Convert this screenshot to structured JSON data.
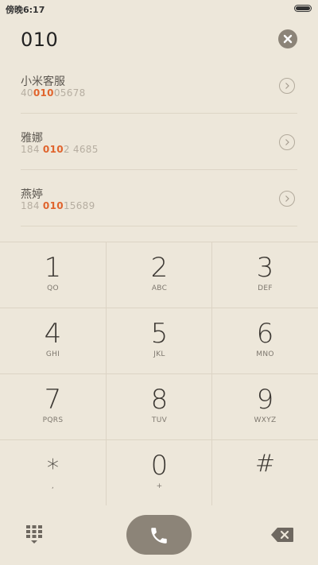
{
  "status_bar": {
    "time": "傍晚6:17"
  },
  "dial_input": {
    "value": "010"
  },
  "results": [
    {
      "name": "小米客服",
      "num_pre": "40",
      "num_hl": "010",
      "num_post": "05678"
    },
    {
      "name": "雅娜",
      "num_pre": "184 ",
      "num_hl": "010",
      "num_post": "2 4685"
    },
    {
      "name": "燕婷",
      "num_pre": "184 ",
      "num_hl": "010",
      "num_post": "15689"
    }
  ],
  "keypad": [
    {
      "digit": "1",
      "letters": "QO"
    },
    {
      "digit": "2",
      "letters": "ABC"
    },
    {
      "digit": "3",
      "letters": "DEF"
    },
    {
      "digit": "4",
      "letters": "GHI"
    },
    {
      "digit": "5",
      "letters": "JKL"
    },
    {
      "digit": "6",
      "letters": "MNO"
    },
    {
      "digit": "7",
      "letters": "PQRS"
    },
    {
      "digit": "8",
      "letters": "TUV"
    },
    {
      "digit": "9",
      "letters": "WXYZ"
    },
    {
      "digit": "∗",
      "letters": ","
    },
    {
      "digit": "0",
      "letters": "+"
    },
    {
      "digit": "#",
      "letters": ""
    }
  ],
  "icons": {
    "clear": "clear-circle-icon",
    "detail": "chevron-right-circle-icon",
    "dialpad": "dialpad-grid-icon",
    "call": "phone-handset-icon",
    "delete": "backspace-icon"
  },
  "colors": {
    "background": "#ede7da",
    "highlight": "#e0642d",
    "button": "#8c8478"
  }
}
